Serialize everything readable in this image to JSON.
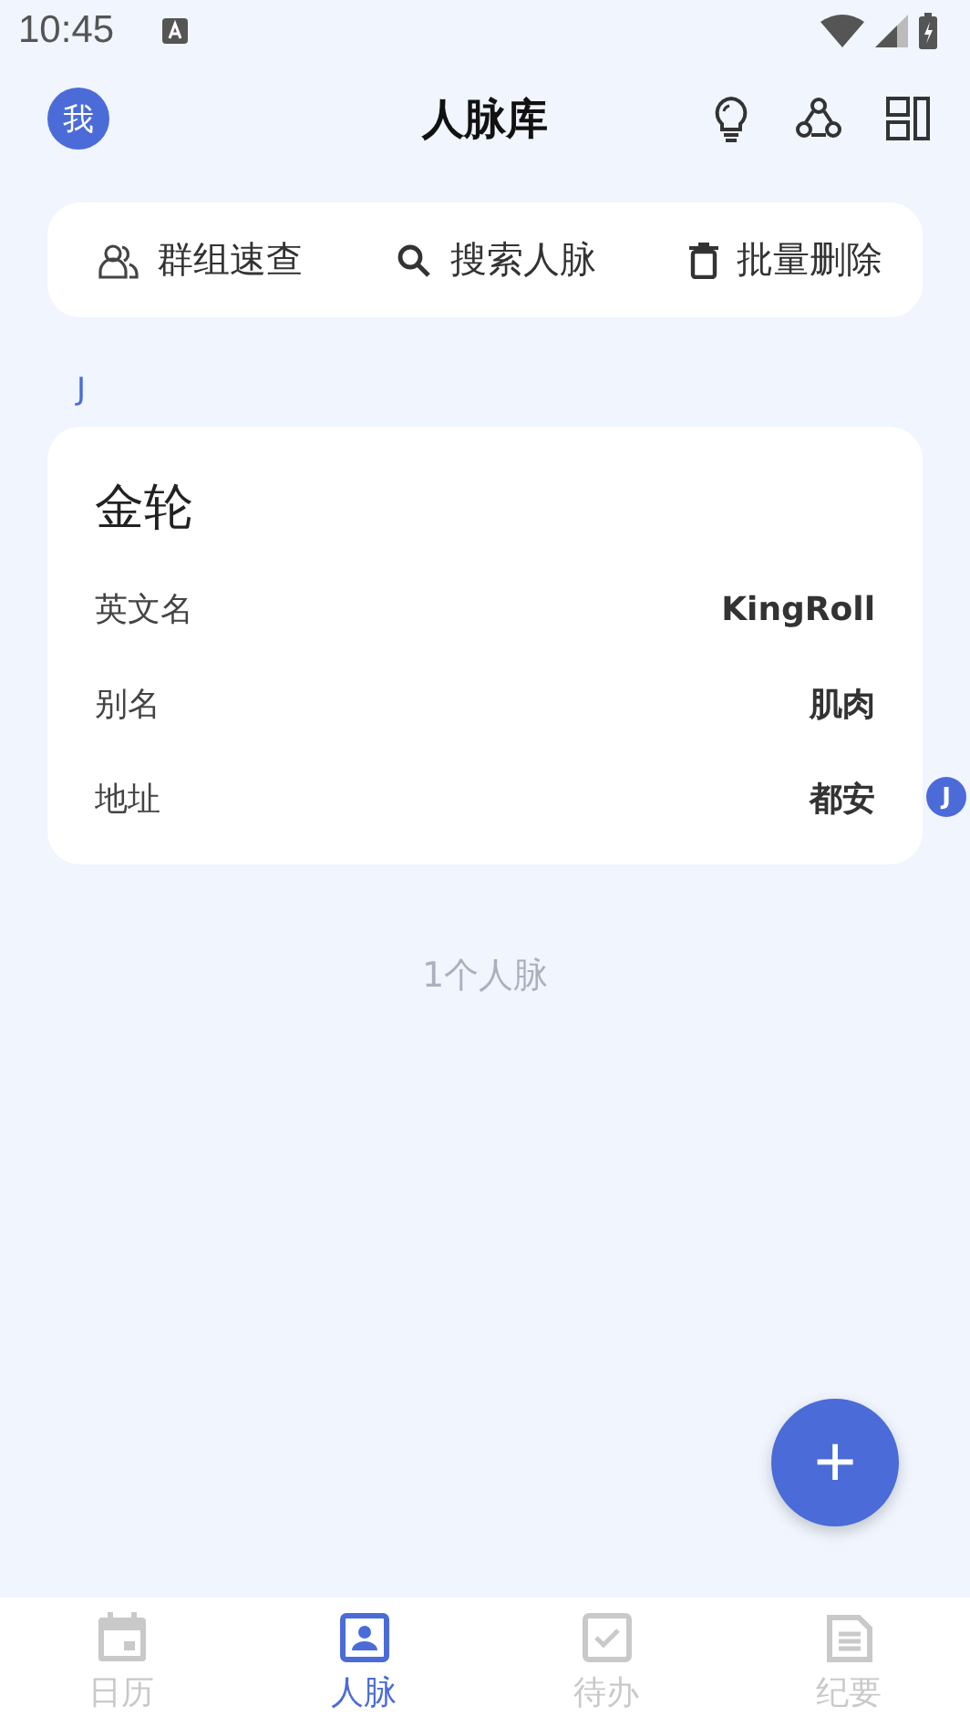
{
  "status_bar": {
    "time": "10:45"
  },
  "header": {
    "avatar": "我",
    "title": "人脉库"
  },
  "toolbar": [
    {
      "kind": "group",
      "label": "群组速查"
    },
    {
      "kind": "search",
      "label": "搜索人脉"
    },
    {
      "kind": "delete",
      "label": "批量删除"
    }
  ],
  "sections": [
    {
      "letter": "J",
      "contacts": [
        {
          "name": "金轮",
          "fields": [
            {
              "label": "英文名",
              "value": "KingRoll"
            },
            {
              "label": "别名",
              "value": "肌肉"
            },
            {
              "label": "地址",
              "value": "都安"
            }
          ]
        }
      ]
    }
  ],
  "index_bar": [
    "J"
  ],
  "count": "1个人脉",
  "fab": "+",
  "tabs": [
    {
      "kind": "calendar",
      "label": "日历",
      "selected": false
    },
    {
      "kind": "contact",
      "label": "人脉",
      "selected": true
    },
    {
      "kind": "todo",
      "label": "待办",
      "selected": false
    },
    {
      "kind": "notes",
      "label": "纪要",
      "selected": false
    }
  ]
}
